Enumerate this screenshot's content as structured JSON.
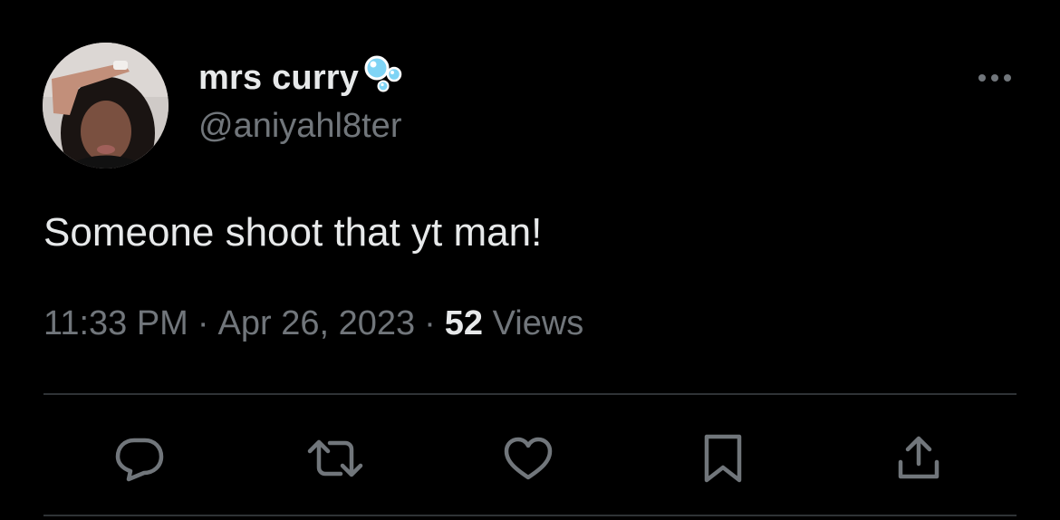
{
  "tweet": {
    "display_name": "mrs curry",
    "handle": "@aniyahl8ter",
    "text": "Someone shoot that yt man!",
    "time": "11:33 PM",
    "separator": "·",
    "date": "Apr 26, 2023",
    "view_count": "52",
    "views_label": "Views"
  },
  "icons": {
    "name_badge": "bubbles-icon",
    "more": "more-options-icon",
    "reply": "reply-icon",
    "retweet": "retweet-icon",
    "like": "like-icon",
    "bookmark": "bookmark-icon",
    "share": "share-icon"
  },
  "colors": {
    "background": "#000000",
    "primary_text": "#e7e9ea",
    "secondary_text": "#71767b",
    "divider": "#2f3336",
    "bubble": "#7fd4f5"
  }
}
